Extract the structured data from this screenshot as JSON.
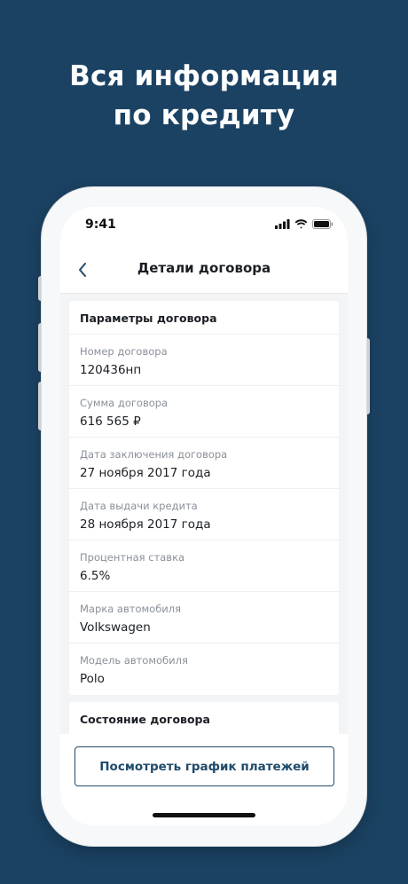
{
  "headline": {
    "line1": "Вся информация",
    "line2": "по кредиту"
  },
  "status_bar": {
    "time": "9:41"
  },
  "nav": {
    "title": "Детали договора"
  },
  "contract_params": {
    "header": "Параметры договора",
    "fields": [
      {
        "label": "Номер договора",
        "value": "120436нп"
      },
      {
        "label": "Сумма договора",
        "value": "616 565 ₽"
      },
      {
        "label": "Дата заключения договора",
        "value": "27 ноября 2017 года"
      },
      {
        "label": "Дата выдачи кредита",
        "value": "28 ноября 2017 года"
      },
      {
        "label": "Процентная ставка",
        "value": "6.5%"
      },
      {
        "label": "Марка автомобиля",
        "value": "Volkswagen"
      },
      {
        "label": "Модель автомобиля",
        "value": "Polo"
      }
    ]
  },
  "contract_state": {
    "header": "Состояние договора"
  },
  "footer": {
    "button_label": "Посмотреть график платежей"
  },
  "colors": {
    "background": "#1b4263",
    "accent": "#1f4a6b"
  },
  "icons": [
    "chevron-left-icon",
    "cellular-signal-icon",
    "wifi-icon",
    "battery-icon"
  ]
}
